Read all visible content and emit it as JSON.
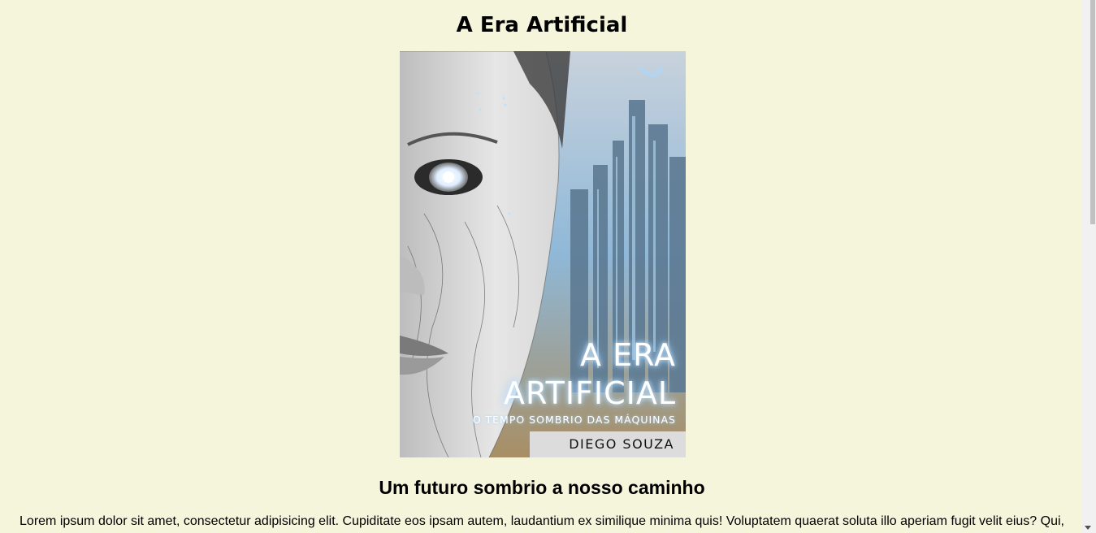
{
  "page": {
    "title": "A Era Artificial",
    "subheading": "Um futuro sombrio a nosso caminho",
    "paragraph": "Lorem ipsum dolor sit amet, consectetur adipisicing elit. Cupiditate eos ipsam autem, laudantium ex similique minima quis! Voluptatem quaerat soluta illo aperiam fugit velit eius? Qui,"
  },
  "cover": {
    "title_line1": "A ERA",
    "title_line2": "ARTIFICIAL",
    "subtitle": "O TEMPO SOMBRIO DAS MÁQUINAS",
    "author": "DIEGO SOUZA"
  },
  "colors": {
    "background": "#f5f5dc",
    "text": "#000000"
  },
  "icons": {
    "scroll_down": "chevron-down-icon"
  }
}
